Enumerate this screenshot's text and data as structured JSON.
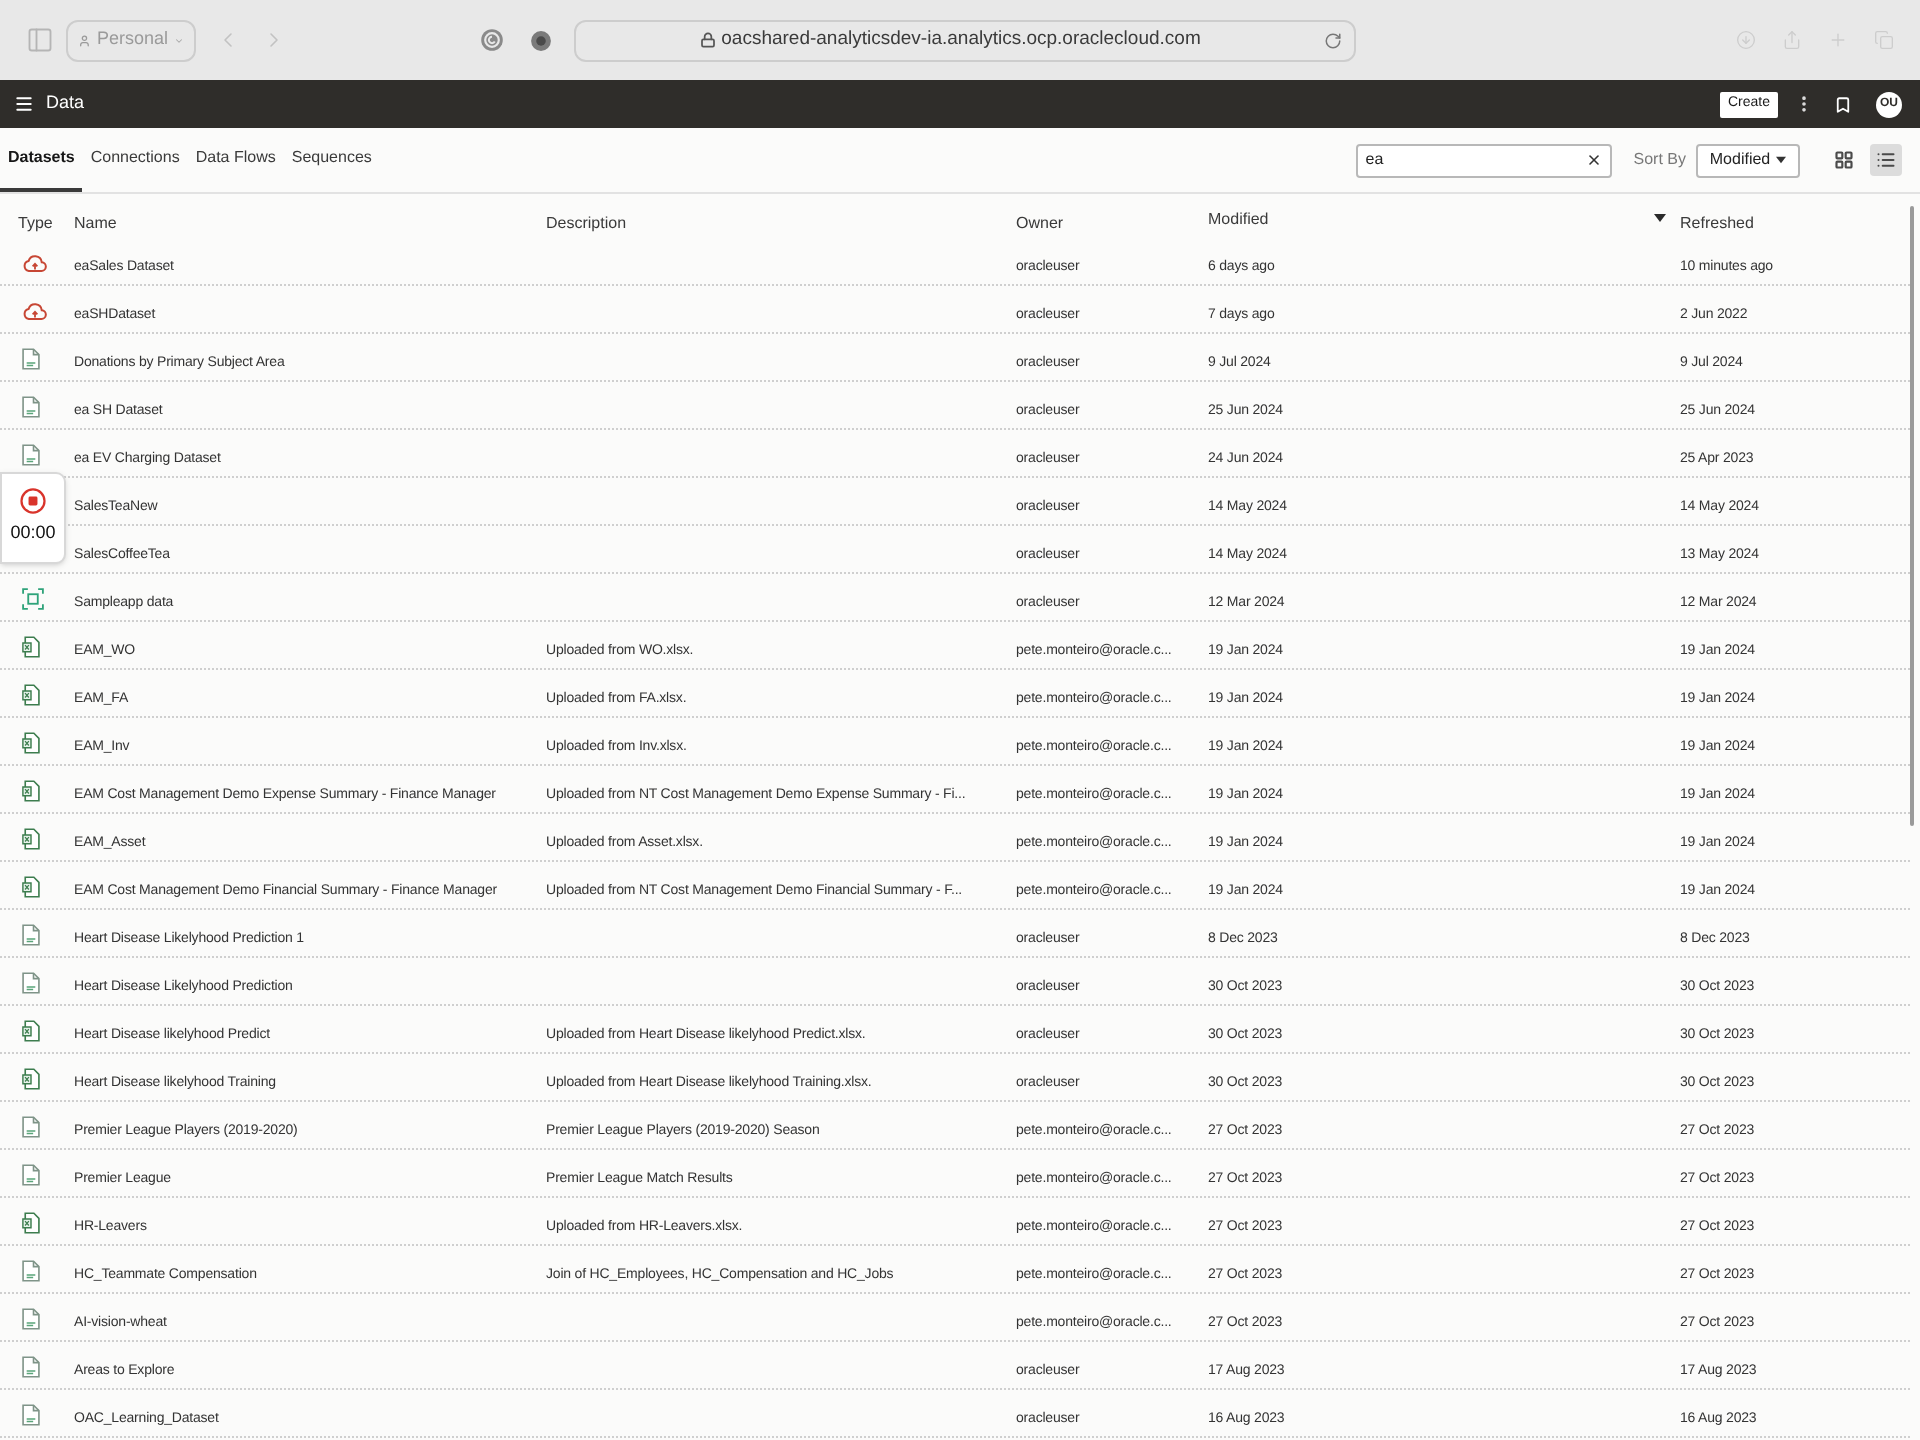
{
  "browser": {
    "profile": "Personal",
    "url": "oacshared-analyticsdev-ia.analytics.ocp.oraclecloud.com"
  },
  "header": {
    "title": "Data",
    "create_button": "Create",
    "avatar": "OU"
  },
  "tabs": [
    {
      "label": "Datasets",
      "selected": true
    },
    {
      "label": "Connections",
      "selected": false
    },
    {
      "label": "Data Flows",
      "selected": false
    },
    {
      "label": "Sequences",
      "selected": false
    }
  ],
  "search": {
    "value": "ea"
  },
  "sort": {
    "label": "Sort By",
    "value": "Modified"
  },
  "views": [
    {
      "kind": "grid",
      "selected": false
    },
    {
      "kind": "list",
      "selected": true
    }
  ],
  "table": {
    "columns": [
      {
        "label": "Type",
        "sorted": false
      },
      {
        "label": "Name",
        "sorted": false
      },
      {
        "label": "Description",
        "sorted": false
      },
      {
        "label": "Owner",
        "sorted": false
      },
      {
        "label": "Modified",
        "sorted": true
      },
      {
        "label": "Refreshed",
        "sorted": false
      }
    ],
    "rows": [
      {
        "kind": "cloud",
        "name": "eaSales Dataset",
        "owner": "oracleuser",
        "modified": "6 days ago",
        "refreshed": "10 minutes ago"
      },
      {
        "kind": "cloud",
        "name": "eaSHDataset",
        "owner": "oracleuser",
        "modified": "7 days ago",
        "refreshed": "2 Jun 2022"
      },
      {
        "kind": "csv",
        "name": "Donations by Primary Subject Area",
        "owner": "oracleuser",
        "modified": "9 Jul 2024",
        "refreshed": "9 Jul 2024"
      },
      {
        "kind": "csv",
        "name": "ea SH Dataset",
        "owner": "oracleuser",
        "modified": "25 Jun 2024",
        "refreshed": "25 Jun 2024"
      },
      {
        "kind": "csv",
        "name": "ea EV Charging Dataset",
        "owner": "oracleuser",
        "modified": "24 Jun 2024",
        "refreshed": "25 Apr 2023"
      },
      {
        "name": "SalesTeaNew",
        "owner": "oracleuser",
        "modified": "14 May 2024",
        "refreshed": "14 May 2024"
      },
      {
        "name": "SalesCoffeeTea",
        "owner": "oracleuser",
        "modified": "14 May 2024",
        "refreshed": "13 May 2024"
      },
      {
        "kind": "subject_area",
        "name": "Sampleapp data",
        "owner": "oracleuser",
        "modified": "12 Mar 2024",
        "refreshed": "12 Mar 2024"
      },
      {
        "kind": "excel",
        "name": "EAM_WO",
        "description": "Uploaded from WO.xlsx.",
        "owner": "pete.monteiro@oracle.c...",
        "modified": "19 Jan 2024",
        "refreshed": "19 Jan 2024"
      },
      {
        "kind": "excel",
        "name": "EAM_FA",
        "description": "Uploaded from FA.xlsx.",
        "owner": "pete.monteiro@oracle.c...",
        "modified": "19 Jan 2024",
        "refreshed": "19 Jan 2024"
      },
      {
        "kind": "excel",
        "name": "EAM_Inv",
        "description": "Uploaded from Inv.xlsx.",
        "owner": "pete.monteiro@oracle.c...",
        "modified": "19 Jan 2024",
        "refreshed": "19 Jan 2024"
      },
      {
        "kind": "excel",
        "name": "EAM Cost Management Demo Expense Summary - Finance Manager",
        "description": "Uploaded from NT Cost Management Demo Expense Summary - Fi...",
        "owner": "pete.monteiro@oracle.c...",
        "modified": "19 Jan 2024",
        "refreshed": "19 Jan 2024"
      },
      {
        "kind": "excel",
        "name": "EAM_Asset",
        "description": "Uploaded from Asset.xlsx.",
        "owner": "pete.monteiro@oracle.c...",
        "modified": "19 Jan 2024",
        "refreshed": "19 Jan 2024"
      },
      {
        "kind": "excel",
        "name": "EAM Cost Management Demo Financial Summary - Finance Manager",
        "description": "Uploaded from NT Cost Management Demo Financial Summary - F...",
        "owner": "pete.monteiro@oracle.c...",
        "modified": "19 Jan 2024",
        "refreshed": "19 Jan 2024"
      },
      {
        "kind": "csv",
        "name": "Heart Disease Likelyhood Prediction 1",
        "owner": "oracleuser",
        "modified": "8 Dec 2023",
        "refreshed": "8 Dec 2023"
      },
      {
        "kind": "csv",
        "name": "Heart Disease Likelyhood Prediction",
        "owner": "oracleuser",
        "modified": "30 Oct 2023",
        "refreshed": "30 Oct 2023"
      },
      {
        "kind": "excel",
        "name": "Heart Disease likelyhood Predict",
        "description": "Uploaded from Heart Disease likelyhood Predict.xlsx.",
        "owner": "oracleuser",
        "modified": "30 Oct 2023",
        "refreshed": "30 Oct 2023"
      },
      {
        "kind": "excel",
        "name": "Heart Disease likelyhood Training",
        "description": "Uploaded from Heart Disease likelyhood Training.xlsx.",
        "owner": "oracleuser",
        "modified": "30 Oct 2023",
        "refreshed": "30 Oct 2023"
      },
      {
        "kind": "csv",
        "name": "Premier League Players (2019-2020)",
        "description": "Premier League Players (2019-2020) Season",
        "owner": "pete.monteiro@oracle.c...",
        "modified": "27 Oct 2023",
        "refreshed": "27 Oct 2023"
      },
      {
        "kind": "csv",
        "name": "Premier League",
        "description": "Premier League Match Results",
        "owner": "pete.monteiro@oracle.c...",
        "modified": "27 Oct 2023",
        "refreshed": "27 Oct 2023"
      },
      {
        "kind": "excel",
        "name": "HR-Leavers",
        "description": "Uploaded from HR-Leavers.xlsx.",
        "owner": "pete.monteiro@oracle.c...",
        "modified": "27 Oct 2023",
        "refreshed": "27 Oct 2023"
      },
      {
        "kind": "csv",
        "name": "HC_Teammate Compensation",
        "description": "Join of HC_Employees, HC_Compensation and HC_Jobs",
        "owner": "pete.monteiro@oracle.c...",
        "modified": "27 Oct 2023",
        "refreshed": "27 Oct 2023"
      },
      {
        "kind": "csv",
        "name": "AI-vision-wheat",
        "owner": "pete.monteiro@oracle.c...",
        "modified": "27 Oct 2023",
        "refreshed": "27 Oct 2023"
      },
      {
        "kind": "csv",
        "name": "Areas to Explore",
        "owner": "oracleuser",
        "modified": "17 Aug 2023",
        "refreshed": "17 Aug 2023"
      },
      {
        "kind": "csv",
        "name": "OAC_Learning_Dataset",
        "owner": "oracleuser",
        "modified": "16 Aug 2023",
        "refreshed": "16 Aug 2023"
      }
    ]
  },
  "recorder": {
    "time": "00:00"
  }
}
